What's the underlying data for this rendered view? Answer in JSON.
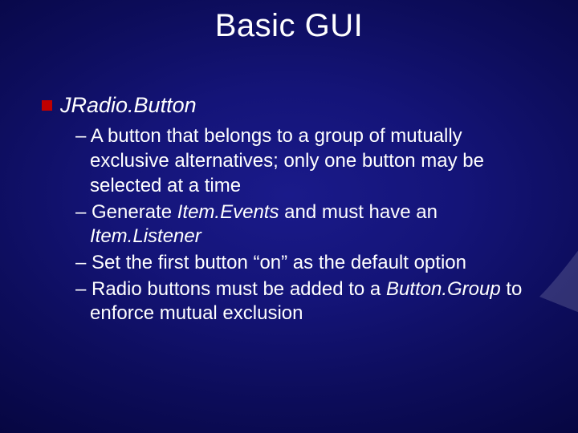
{
  "title": "Basic GUI",
  "heading": "JRadio.Button",
  "bullets": [
    {
      "pre": "– A button that belongs to a group of mutually exclusive alternatives; only one button may be selected at a time",
      "ital": "",
      "post": ""
    },
    {
      "pre": "– Generate ",
      "ital": "Item.Events",
      "post": " and must have an ",
      "ital2": "Item.Listener",
      "post2": ""
    },
    {
      "pre": "– Set the first button “on” as the default option",
      "ital": "",
      "post": ""
    },
    {
      "pre": "– Radio buttons must be added to a ",
      "ital": "Button.Group",
      "post": " to enforce mutual exclusion"
    }
  ]
}
